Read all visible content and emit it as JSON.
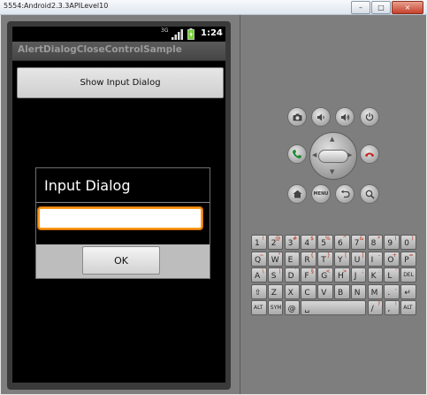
{
  "window": {
    "title": "5554:Android2.3.3APILevel10",
    "minimize_glyph": "–",
    "maximize_glyph": "□",
    "close_glyph": "×"
  },
  "statusbar": {
    "network_label": "3G",
    "time": "1:24"
  },
  "app": {
    "title": "AlertDialogCloseControlSample",
    "show_dialog_button": "Show Input Dialog"
  },
  "dialog": {
    "title": "Input Dialog",
    "input_value": "",
    "ok_button": "OK"
  },
  "controls": {
    "row1": [
      "camera-icon",
      "volume-down-icon",
      "volume-up-icon",
      "power-icon"
    ],
    "row2": [
      "call-icon",
      "dpad",
      "end-call-icon"
    ],
    "row3": [
      "home-icon",
      "menu-button",
      "back-icon",
      "search-icon"
    ],
    "menu_label": "MENU"
  },
  "keyboard": {
    "rows": [
      [
        {
          "main": "1",
          "alt": "!"
        },
        {
          "main": "2",
          "alt": "@"
        },
        {
          "main": "3",
          "alt": "#"
        },
        {
          "main": "4",
          "alt": "$"
        },
        {
          "main": "5",
          "alt": "%"
        },
        {
          "main": "6",
          "alt": "^"
        },
        {
          "main": "7",
          "alt": "&"
        },
        {
          "main": "8",
          "alt": "*"
        },
        {
          "main": "9",
          "alt": "("
        },
        {
          "main": "0",
          "alt": ")"
        }
      ],
      [
        {
          "main": "Q",
          "alt": "~"
        },
        {
          "main": "W",
          "alt": "\""
        },
        {
          "main": "E",
          "alt": "´"
        },
        {
          "main": "R",
          "alt": "{"
        },
        {
          "main": "T",
          "alt": "}"
        },
        {
          "main": "Y",
          "alt": "["
        },
        {
          "main": "U",
          "alt": "]"
        },
        {
          "main": "I",
          "alt": "-"
        },
        {
          "main": "O",
          "alt": "+"
        },
        {
          "main": "P",
          "alt": "="
        }
      ],
      [
        {
          "main": "A",
          "alt": "\\"
        },
        {
          "main": "S",
          "alt": "|"
        },
        {
          "main": "D",
          "alt": "`"
        },
        {
          "main": "F",
          "alt": "§"
        },
        {
          "main": "G",
          "alt": "<"
        },
        {
          "main": "H",
          "alt": ">"
        },
        {
          "main": "J",
          "alt": ";"
        },
        {
          "main": "K",
          "alt": ":"
        },
        {
          "main": "L",
          "alt": "'"
        },
        {
          "main": "DEL",
          "alt": ""
        }
      ],
      [
        {
          "main": "⇧",
          "alt": ""
        },
        {
          "main": "Z",
          "alt": ""
        },
        {
          "main": "X",
          "alt": ""
        },
        {
          "main": "C",
          "alt": ""
        },
        {
          "main": "V",
          "alt": ""
        },
        {
          "main": "B",
          "alt": ""
        },
        {
          "main": "N",
          "alt": ""
        },
        {
          "main": "M",
          "alt": ""
        },
        {
          "main": ".",
          "alt": ","
        },
        {
          "main": "↵",
          "alt": ""
        }
      ],
      [
        {
          "main": "ALT",
          "alt": ""
        },
        {
          "main": "SYM",
          "alt": ""
        },
        {
          "main": "@",
          "alt": ""
        },
        {
          "main": "␣",
          "alt": ""
        },
        {
          "main": "/",
          "alt": "?"
        },
        {
          "main": ",",
          "alt": "!"
        },
        {
          "main": "ALT",
          "alt": ""
        }
      ]
    ]
  }
}
